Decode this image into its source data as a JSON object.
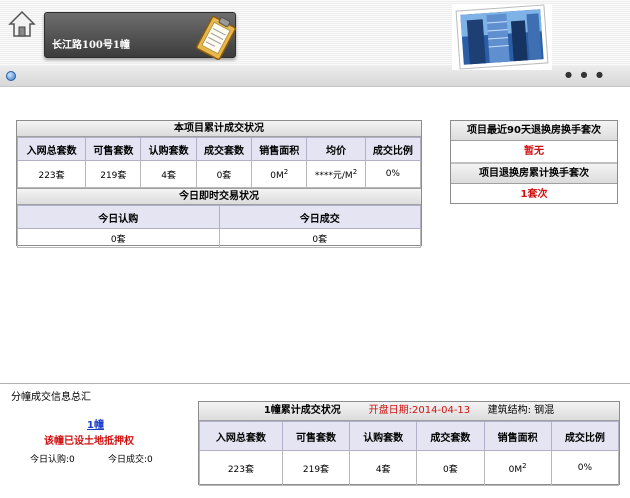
{
  "header": {
    "building_title": "长江路100号1幢"
  },
  "icons": {
    "home": "home-icon",
    "clipboard": "clipboard-icon",
    "photo": "building-photo",
    "dot": "blue-dot-icon"
  },
  "main_table": {
    "title": "本项目累计成交状况",
    "columns": [
      "入网总套数",
      "可售套数",
      "认购套数",
      "成交套数",
      "销售面积",
      "均价",
      "成交比例"
    ],
    "row": {
      "total": "223套",
      "available": "219套",
      "subscribed": "4套",
      "sold": "0套",
      "area_value": "0M",
      "area_sup": "2",
      "avg_price_value": "****元/M",
      "avg_price_sup": "2",
      "ratio": "0%"
    },
    "today_title": "今日即时交易状况",
    "today_columns": [
      "今日认购",
      "今日成交"
    ],
    "today_row": [
      "0套",
      "0套"
    ]
  },
  "side_table": {
    "title1": "项目最近90天退换房换手套次",
    "value1": "暂无",
    "title2": "项目退换房累计换手套次",
    "value2": "1套次"
  },
  "bottom": {
    "label": "分幢成交信息总汇",
    "link": "1幢",
    "notice": "该幢已设土地抵押权",
    "today_sub": "今日认购:0",
    "today_deal": "今日成交:0"
  },
  "bottom_table": {
    "title": "1幢累计成交状况",
    "open_date": "开盘日期:2014-04-13",
    "structure": "建筑结构: 钢混",
    "columns": [
      "入网总套数",
      "可售套数",
      "认购套数",
      "成交套数",
      "销售面积",
      "成交比例"
    ],
    "row": {
      "total": "223套",
      "available": "219套",
      "subscribed": "4套",
      "sold": "0套",
      "area_value": "0M",
      "area_sup": "2",
      "ratio": "0%"
    }
  },
  "colors": {
    "red": "#d01010",
    "link": "#1a3cc8",
    "header_cell_bg": "#e4e4f2"
  }
}
